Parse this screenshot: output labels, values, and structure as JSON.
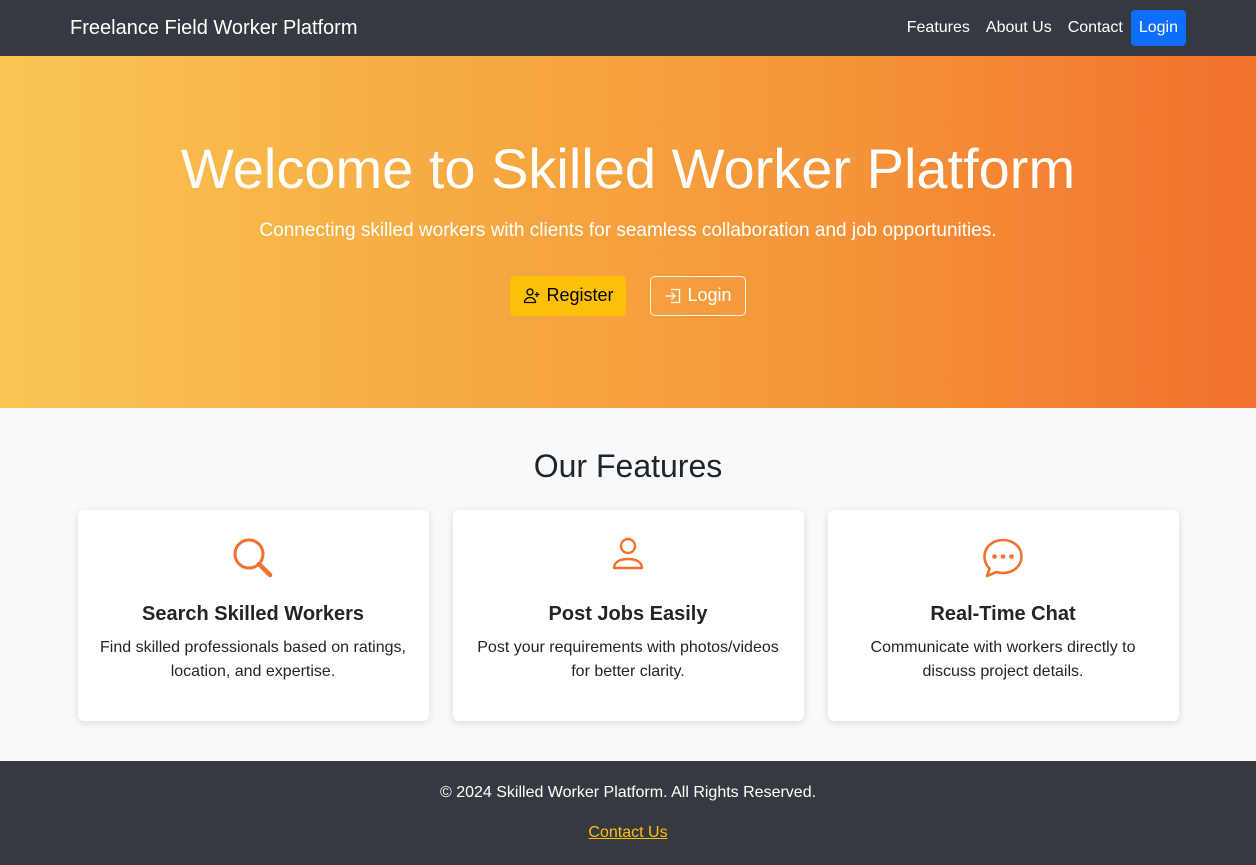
{
  "nav": {
    "brand": "Freelance Field Worker Platform",
    "links": [
      "Features",
      "About Us",
      "Contact"
    ],
    "login_label": "Login"
  },
  "hero": {
    "title": "Welcome to Skilled Worker Platform",
    "subtitle": "Connecting skilled workers with clients for seamless collaboration and job opportunities.",
    "register_label": "Register",
    "login_label": "Login"
  },
  "features": {
    "title": "Our Features",
    "cards": [
      {
        "icon": "search-icon",
        "title": "Search Skilled Workers",
        "text": "Find skilled professionals based on ratings, location, and expertise."
      },
      {
        "icon": "person-icon",
        "title": "Post Jobs Easily",
        "text": "Post your requirements with photos/videos for better clarity."
      },
      {
        "icon": "chat-icon",
        "title": "Real-Time Chat",
        "text": "Communicate with workers directly to discuss project details."
      }
    ]
  },
  "footer": {
    "copyright": "© 2024 Skilled Worker Platform. All Rights Reserved.",
    "contact_label": "Contact Us"
  },
  "colors": {
    "accent": "#f2712c",
    "primary": "#0d6efd",
    "warning": "#ffc107",
    "dark": "#343a40"
  }
}
